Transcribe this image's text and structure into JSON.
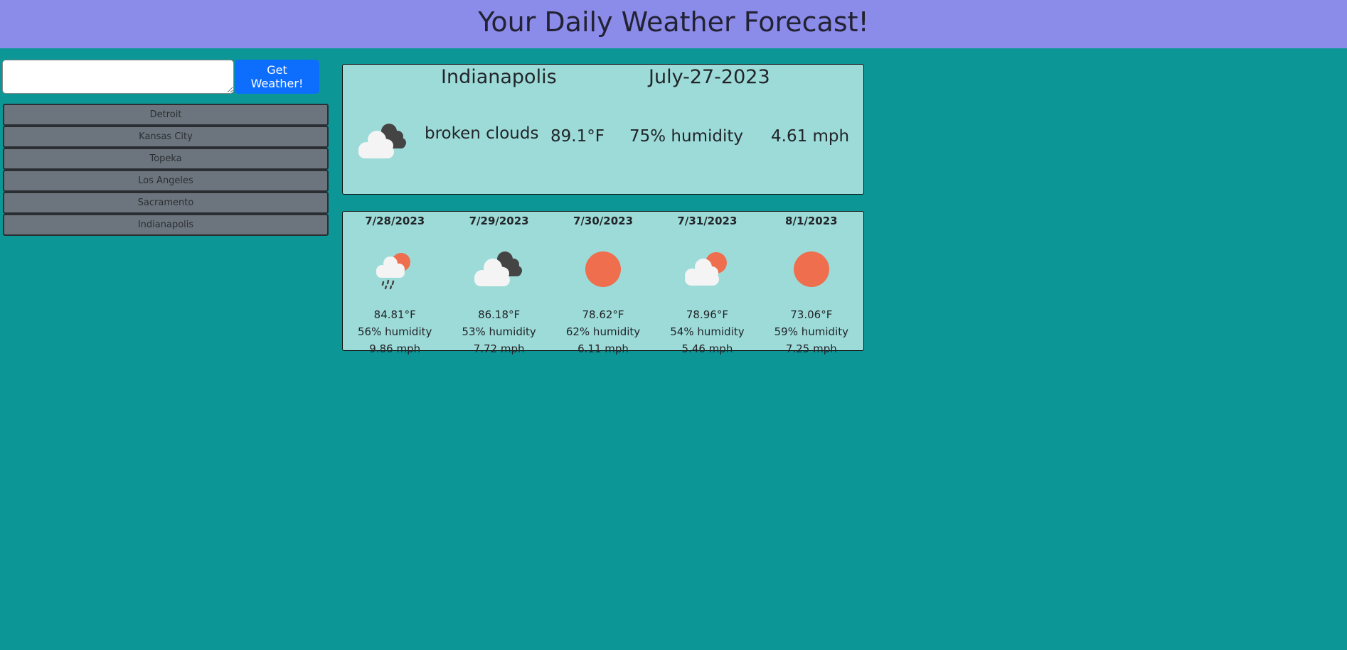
{
  "header": {
    "title": "Your Daily Weather Forecast!"
  },
  "search": {
    "value": "",
    "button_label": "Get Weather!"
  },
  "history": [
    "Detroit",
    "Kansas City",
    "Topeka",
    "Los Angeles",
    "Sacramento",
    "Indianapolis"
  ],
  "current": {
    "city": "Indianapolis",
    "date": "July-27-2023",
    "icon": "broken-clouds-icon",
    "description": "broken clouds",
    "temp": "89.1°F",
    "humidity": "75% humidity",
    "wind": "4.61 mph"
  },
  "forecast": [
    {
      "date": "7/28/2023",
      "icon": "rain-icon",
      "temp": "84.81°F",
      "humidity": "56% humidity",
      "wind": "9.86 mph"
    },
    {
      "date": "7/29/2023",
      "icon": "broken-clouds-icon",
      "temp": "86.18°F",
      "humidity": "53% humidity",
      "wind": "7.72 mph"
    },
    {
      "date": "7/30/2023",
      "icon": "clear-sky-icon",
      "temp": "78.62°F",
      "humidity": "62% humidity",
      "wind": "6.11 mph"
    },
    {
      "date": "7/31/2023",
      "icon": "few-clouds-icon",
      "temp": "78.96°F",
      "humidity": "54% humidity",
      "wind": "5.46 mph"
    },
    {
      "date": "8/1/2023",
      "icon": "clear-sky-icon",
      "temp": "73.06°F",
      "humidity": "59% humidity",
      "wind": "7.25 mph"
    }
  ],
  "colors": {
    "background": "#0c9696",
    "header": "#8b8bea",
    "card": "#9ddbd8",
    "button": "#0d6efd",
    "history_button": "#6c757d",
    "sun": "#ee6e4e"
  }
}
